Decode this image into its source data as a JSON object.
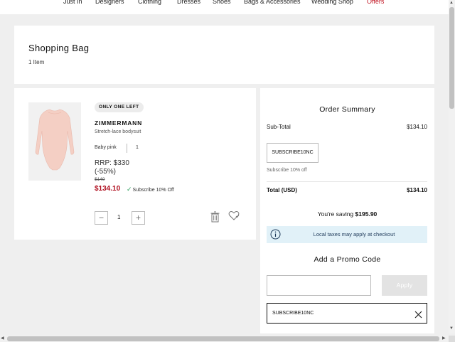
{
  "nav": {
    "items": [
      "Just In",
      "Designers",
      "Clothing",
      "Dresses",
      "Shoes",
      "Bags & Accessories",
      "Wedding Shop",
      "Offers"
    ]
  },
  "bag": {
    "title": "Shopping Bag",
    "count": "1 Item"
  },
  "item": {
    "badge": "ONLY ONE LEFT",
    "brand": "ZIMMERMANN",
    "name": "Stretch-lace bodysuit",
    "color": "Baby pink",
    "size": "1",
    "rrp": "RRP: $330 (-55%)",
    "old_price": "$149",
    "price": "$134.10",
    "subscribe_tag": "Subscribe 10% Off",
    "quantity": "1",
    "image_color": "#f3cfc4"
  },
  "summary": {
    "title": "Order Summary",
    "subtotal_label": "Sub-Total",
    "subtotal_value": "$134.10",
    "code": "SUBSCRIBE10NC",
    "code_desc": "Subscribe 10% off",
    "total_label": "Total (USD)",
    "total_value": "$134.10",
    "saving_prefix": "You're saving",
    "saving_value": "$195.90",
    "tax_note": "Local taxes may apply at checkout",
    "promo_title": "Add a Promo Code",
    "promo_placeholder": "",
    "apply_label": "Apply",
    "applied_code": "SUBSCRIBE10NC"
  },
  "colors": {
    "sale": "#b01020",
    "offers": "#c0101e",
    "tax_box": "#e1f1f8",
    "tick": "#2a9d5b"
  }
}
